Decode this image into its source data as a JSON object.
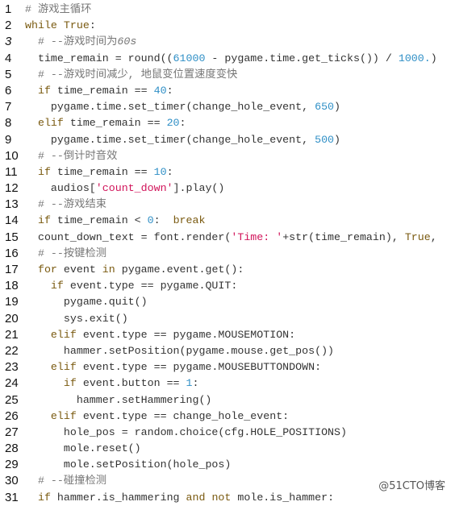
{
  "watermark": "@51CTO博客",
  "lines": [
    {
      "n": "1",
      "indent": "",
      "tokens": [
        {
          "t": "cm",
          "v": "# 游戏主循环"
        }
      ]
    },
    {
      "n": "2",
      "indent": "",
      "tokens": [
        {
          "t": "kw",
          "v": "while"
        },
        {
          "t": "tx",
          "v": " "
        },
        {
          "t": "kw",
          "v": "True"
        },
        {
          "t": "tx",
          "v": ":"
        }
      ]
    },
    {
      "n": "3",
      "italic": true,
      "indent": "  ",
      "tokens": [
        {
          "t": "cm",
          "v": "# --游戏时间为"
        },
        {
          "t": "cmi",
          "v": "60s"
        }
      ]
    },
    {
      "n": "4",
      "indent": "  ",
      "tokens": [
        {
          "t": "tx",
          "v": "time_remain = round(("
        },
        {
          "t": "num",
          "v": "61000"
        },
        {
          "t": "tx",
          "v": " - pygame.time.get_ticks()) / "
        },
        {
          "t": "num",
          "v": "1000."
        },
        {
          "t": "tx",
          "v": ")"
        }
      ]
    },
    {
      "n": "5",
      "indent": "  ",
      "tokens": [
        {
          "t": "cm",
          "v": "# --游戏时间减少, 地鼠变位置速度变快"
        }
      ]
    },
    {
      "n": "6",
      "indent": "  ",
      "tokens": [
        {
          "t": "kw",
          "v": "if"
        },
        {
          "t": "tx",
          "v": " time_remain == "
        },
        {
          "t": "num",
          "v": "40"
        },
        {
          "t": "tx",
          "v": ":"
        }
      ]
    },
    {
      "n": "7",
      "indent": "    ",
      "tokens": [
        {
          "t": "tx",
          "v": "pygame.time.set_timer(change_hole_event, "
        },
        {
          "t": "num",
          "v": "650"
        },
        {
          "t": "tx",
          "v": ")"
        }
      ]
    },
    {
      "n": "8",
      "indent": "  ",
      "tokens": [
        {
          "t": "kw",
          "v": "elif"
        },
        {
          "t": "tx",
          "v": " time_remain == "
        },
        {
          "t": "num",
          "v": "20"
        },
        {
          "t": "tx",
          "v": ":"
        }
      ]
    },
    {
      "n": "9",
      "indent": "    ",
      "tokens": [
        {
          "t": "tx",
          "v": "pygame.time.set_timer(change_hole_event, "
        },
        {
          "t": "num",
          "v": "500"
        },
        {
          "t": "tx",
          "v": ")"
        }
      ]
    },
    {
      "n": "10",
      "indent": "  ",
      "tokens": [
        {
          "t": "cm",
          "v": "# --倒计时音效"
        }
      ]
    },
    {
      "n": "11",
      "indent": "  ",
      "tokens": [
        {
          "t": "kw",
          "v": "if"
        },
        {
          "t": "tx",
          "v": " time_remain == "
        },
        {
          "t": "num",
          "v": "10"
        },
        {
          "t": "tx",
          "v": ":"
        }
      ]
    },
    {
      "n": "12",
      "indent": "    ",
      "tokens": [
        {
          "t": "tx",
          "v": "audios["
        },
        {
          "t": "str",
          "v": "'count_down'"
        },
        {
          "t": "tx",
          "v": "].play()"
        }
      ]
    },
    {
      "n": "13",
      "indent": "  ",
      "tokens": [
        {
          "t": "cm",
          "v": "# --游戏结束"
        }
      ]
    },
    {
      "n": "14",
      "indent": "  ",
      "tokens": [
        {
          "t": "kw",
          "v": "if"
        },
        {
          "t": "tx",
          "v": " time_remain < "
        },
        {
          "t": "num",
          "v": "0"
        },
        {
          "t": "tx",
          "v": ":  "
        },
        {
          "t": "kw",
          "v": "break"
        }
      ]
    },
    {
      "n": "15",
      "indent": "  ",
      "tokens": [
        {
          "t": "tx",
          "v": "count_down_text = font.render("
        },
        {
          "t": "str",
          "v": "'Time: '"
        },
        {
          "t": "tx",
          "v": "+str(time_remain), "
        },
        {
          "t": "kw",
          "v": "True"
        },
        {
          "t": "tx",
          "v": ", "
        }
      ]
    },
    {
      "n": "16",
      "indent": "  ",
      "tokens": [
        {
          "t": "cm",
          "v": "# --按键检测"
        }
      ]
    },
    {
      "n": "17",
      "indent": "  ",
      "tokens": [
        {
          "t": "kw",
          "v": "for"
        },
        {
          "t": "tx",
          "v": " event "
        },
        {
          "t": "kw",
          "v": "in"
        },
        {
          "t": "tx",
          "v": " pygame.event.get():"
        }
      ]
    },
    {
      "n": "18",
      "indent": "    ",
      "tokens": [
        {
          "t": "kw",
          "v": "if"
        },
        {
          "t": "tx",
          "v": " event.type == pygame.QUIT:"
        }
      ]
    },
    {
      "n": "19",
      "indent": "      ",
      "tokens": [
        {
          "t": "tx",
          "v": "pygame.quit()"
        }
      ]
    },
    {
      "n": "20",
      "indent": "      ",
      "tokens": [
        {
          "t": "tx",
          "v": "sys.exit()"
        }
      ]
    },
    {
      "n": "21",
      "indent": "    ",
      "tokens": [
        {
          "t": "kw",
          "v": "elif"
        },
        {
          "t": "tx",
          "v": " event.type == pygame.MOUSEMOTION:"
        }
      ]
    },
    {
      "n": "22",
      "indent": "      ",
      "tokens": [
        {
          "t": "tx",
          "v": "hammer.setPosition(pygame.mouse.get_pos())"
        }
      ]
    },
    {
      "n": "23",
      "indent": "    ",
      "tokens": [
        {
          "t": "kw",
          "v": "elif"
        },
        {
          "t": "tx",
          "v": " event.type == pygame.MOUSEBUTTONDOWN:"
        }
      ]
    },
    {
      "n": "24",
      "indent": "      ",
      "tokens": [
        {
          "t": "kw",
          "v": "if"
        },
        {
          "t": "tx",
          "v": " event.button == "
        },
        {
          "t": "num",
          "v": "1"
        },
        {
          "t": "tx",
          "v": ":"
        }
      ]
    },
    {
      "n": "25",
      "indent": "        ",
      "tokens": [
        {
          "t": "tx",
          "v": "hammer.setHammering()"
        }
      ]
    },
    {
      "n": "26",
      "indent": "    ",
      "tokens": [
        {
          "t": "kw",
          "v": "elif"
        },
        {
          "t": "tx",
          "v": " event.type == change_hole_event:"
        }
      ]
    },
    {
      "n": "27",
      "indent": "      ",
      "tokens": [
        {
          "t": "tx",
          "v": "hole_pos = random.choice(cfg.HOLE_POSITIONS)"
        }
      ]
    },
    {
      "n": "28",
      "indent": "      ",
      "tokens": [
        {
          "t": "tx",
          "v": "mole.reset()"
        }
      ]
    },
    {
      "n": "29",
      "indent": "      ",
      "tokens": [
        {
          "t": "tx",
          "v": "mole.setPosition(hole_pos)"
        }
      ]
    },
    {
      "n": "30",
      "indent": "  ",
      "tokens": [
        {
          "t": "cm",
          "v": "# --碰撞检测"
        }
      ]
    },
    {
      "n": "31",
      "indent": "  ",
      "tokens": [
        {
          "t": "kw",
          "v": "if"
        },
        {
          "t": "tx",
          "v": " hammer.is_hammering "
        },
        {
          "t": "kw",
          "v": "and"
        },
        {
          "t": "tx",
          "v": " "
        },
        {
          "t": "kw",
          "v": "not"
        },
        {
          "t": "tx",
          "v": " mole.is_hammer:"
        }
      ]
    }
  ]
}
